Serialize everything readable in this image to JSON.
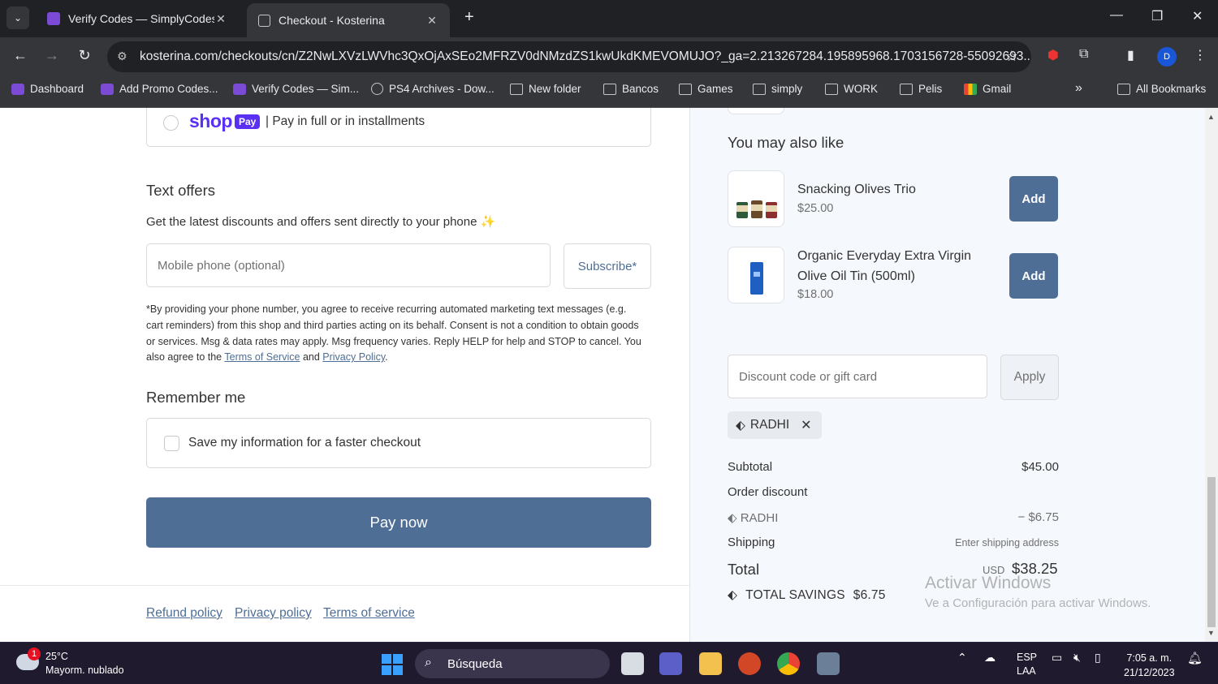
{
  "browser": {
    "tabs": [
      {
        "title": "Verify Codes — SimplyCodes",
        "active": false
      },
      {
        "title": "Checkout - Kosterina",
        "active": true
      }
    ],
    "url": "kosterina.com/checkouts/cn/Z2NwLXVzLWVhc3QxOjAxSEo2MFRZV0dNMzdZS1kwUkdKMEVOMUJO?_ga=2.213267284.195895968.1703156728-55092693...",
    "profile_initial": "D",
    "bookmarks": [
      "Dashboard",
      "Add Promo Codes...",
      "Verify Codes — Sim...",
      "PS4 Archives - Dow...",
      "New folder",
      "Bancos",
      "Games",
      "simply",
      "WORK",
      "Pelis",
      "Gmail"
    ],
    "all_bookmarks": "All Bookmarks",
    "more": "»"
  },
  "checkout": {
    "shop_pay": {
      "logo": "shop",
      "pill": "Pay",
      "text": "| Pay in full or in installments"
    },
    "text_offers": {
      "heading": "Text offers",
      "description": "Get the latest discounts and offers sent directly to your phone ✨",
      "phone_placeholder": "Mobile phone (optional)",
      "subscribe_label": "Subscribe*",
      "legal_prefix": "*By providing your phone number, you agree to receive recurring automated marketing text messages (e.g. cart reminders) from this shop and third parties acting on its behalf. Consent is not a condition to obtain goods or services. Msg & data rates may apply. Msg frequency varies. Reply HELP for help and STOP to cancel. You also agree to the ",
      "terms_link": "Terms of Service",
      "and": " and ",
      "privacy_link": "Privacy Policy",
      "end": "."
    },
    "remember": {
      "heading": "Remember me",
      "label": "Save my information for a faster checkout"
    },
    "pay_now": "Pay now",
    "footer_links": [
      "Refund policy",
      "Privacy policy",
      "Terms of service"
    ]
  },
  "summary": {
    "upsell_title": "You may also like",
    "products": [
      {
        "name": "Snacking Olives Trio",
        "price": "$25.00",
        "add": "Add"
      },
      {
        "name": "Organic Everyday Extra Virgin Olive Oil Tin (500ml)",
        "price": "$18.00",
        "add": "Add"
      }
    ],
    "discount_placeholder": "Discount code or gift card",
    "apply_label": "Apply",
    "applied_code": "RADHI",
    "subtotal_label": "Subtotal",
    "subtotal_value": "$45.00",
    "order_discount_label": "Order discount",
    "discount_code": "RADHI",
    "discount_value": "− $6.75",
    "shipping_label": "Shipping",
    "shipping_value": "Enter shipping address",
    "total_label": "Total",
    "currency": "USD",
    "total_value": "$38.25",
    "savings_label": "TOTAL SAVINGS",
    "savings_value": "$6.75",
    "watermark_title": "Activar Windows",
    "watermark_sub": "Ve a Configuración para activar Windows."
  },
  "taskbar": {
    "weather_badge": "1",
    "temperature": "25°C",
    "condition": "Mayorm. nublado",
    "search": "Búsqueda",
    "lang1": "ESP",
    "lang2": "LAA",
    "time": "7:05 a. m.",
    "date": "21/12/2023"
  },
  "colors": {
    "accent": "#4e6e96",
    "shop_purple": "#5a31f4"
  }
}
